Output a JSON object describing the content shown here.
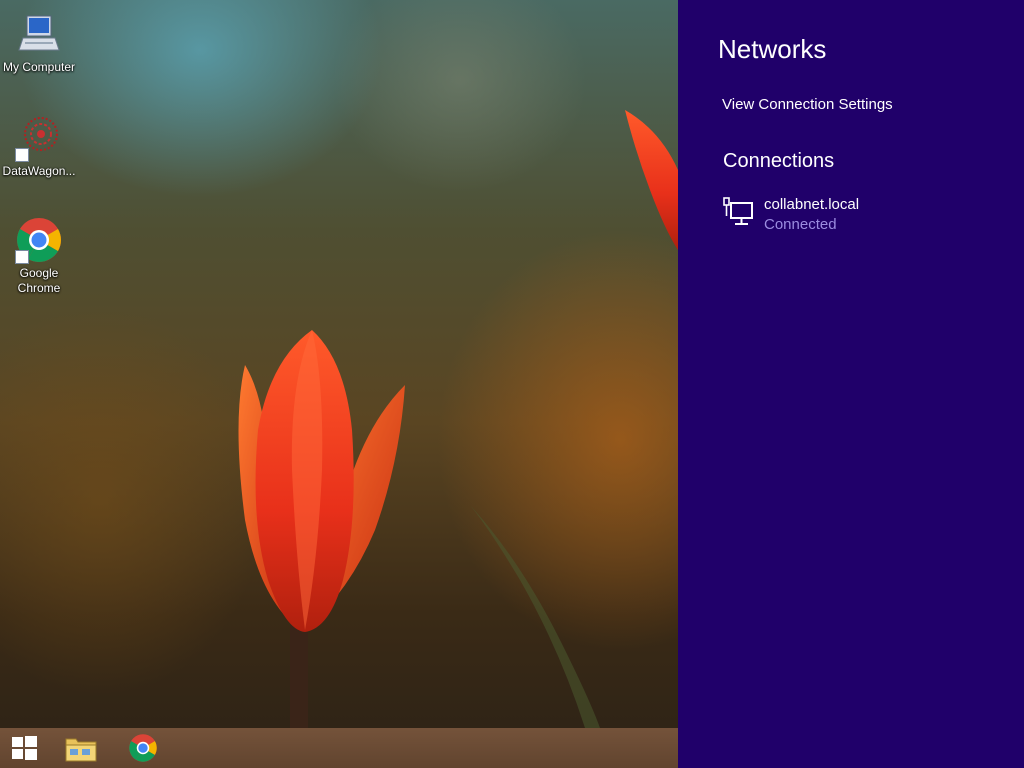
{
  "desktop": {
    "icons": [
      {
        "label": "My Computer",
        "icon": "my-computer-icon"
      },
      {
        "label": "DataWagon...",
        "icon": "datawagon-icon"
      },
      {
        "label": "Google Chrome",
        "icon": "chrome-icon"
      }
    ]
  },
  "taskbar": {
    "items": [
      {
        "icon": "windows-start-icon"
      },
      {
        "icon": "file-explorer-icon"
      },
      {
        "icon": "chrome-icon"
      }
    ]
  },
  "networks_panel": {
    "title": "Networks",
    "view_settings_label": "View Connection Settings",
    "connections_heading": "Connections",
    "connections": [
      {
        "name": "collabnet.local",
        "status": "Connected",
        "icon": "ethernet-network-icon"
      }
    ],
    "colors": {
      "background": "#20006a",
      "status_text": "#9b8ce0"
    }
  }
}
